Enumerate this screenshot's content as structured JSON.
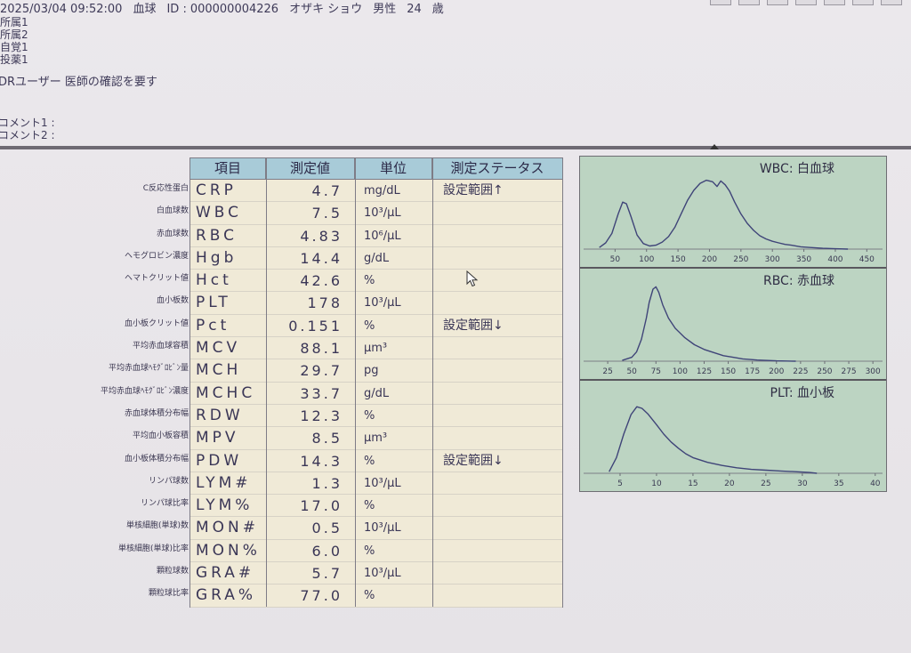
{
  "header": {
    "datetime": "2025/03/04 09:52:00",
    "test": "血球",
    "id_label": "ID :",
    "id": "000000004226",
    "name": "オザキ ショウ",
    "sex": "男性",
    "age": "24",
    "age_unit": "歳",
    "lines": [
      "所属1",
      "所属2",
      "自覚1",
      "投薬1"
    ],
    "dr_note": "DRユーザー 医師の確認を要す",
    "comment1": "コメント1 :",
    "comment2": "コメント2 :"
  },
  "table": {
    "headers": [
      "項目",
      "測定値",
      "単位",
      "測定ステータス"
    ],
    "rows": [
      {
        "label": "C反応性蛋白",
        "item": "CRP",
        "value": "4.7",
        "unit": "mg/dL",
        "status": "設定範囲↑"
      },
      {
        "label": "白血球数",
        "item": "WBC",
        "value": "7.5",
        "unit": "10³/μL",
        "status": ""
      },
      {
        "label": "赤血球数",
        "item": "RBC",
        "value": "4.83",
        "unit": "10⁶/μL",
        "status": ""
      },
      {
        "label": "ヘモグロビン濃度",
        "item": "Hgb",
        "value": "14.4",
        "unit": "g/dL",
        "status": ""
      },
      {
        "label": "ヘマトクリット値",
        "item": "Hct",
        "value": "42.6",
        "unit": "%",
        "status": ""
      },
      {
        "label": "血小板数",
        "item": "PLT",
        "value": "178",
        "unit": "10³/μL",
        "status": ""
      },
      {
        "label": "血小板クリット値",
        "item": "Pct",
        "value": "0.151",
        "unit": "%",
        "status": "設定範囲↓"
      },
      {
        "label": "平均赤血球容積",
        "item": "MCV",
        "value": "88.1",
        "unit": "μm³",
        "status": ""
      },
      {
        "label": "平均赤血球ﾍﾓｸﾞﾛﾋﾞﾝ量",
        "item": "MCH",
        "value": "29.7",
        "unit": "pg",
        "status": ""
      },
      {
        "label": "平均赤血球ﾍﾓｸﾞﾛﾋﾞﾝ濃度",
        "item": "MCHC",
        "value": "33.7",
        "unit": "g/dL",
        "status": ""
      },
      {
        "label": "赤血球体積分布幅",
        "item": "RDW",
        "value": "12.3",
        "unit": "%",
        "status": ""
      },
      {
        "label": "平均血小板容積",
        "item": "MPV",
        "value": "8.5",
        "unit": "μm³",
        "status": ""
      },
      {
        "label": "血小板体積分布幅",
        "item": "PDW",
        "value": "14.3",
        "unit": "%",
        "status": "設定範囲↓"
      },
      {
        "label": "リンパ球数",
        "item": "LYM#",
        "value": "1.3",
        "unit": "10³/μL",
        "status": ""
      },
      {
        "label": "リンパ球比率",
        "item": "LYM%",
        "value": "17.0",
        "unit": "%",
        "status": ""
      },
      {
        "label": "単核細胞(単球)数",
        "item": "MON#",
        "value": "0.5",
        "unit": "10³/μL",
        "status": ""
      },
      {
        "label": "単核細胞(単球)比率",
        "item": "MON%",
        "value": "6.0",
        "unit": "%",
        "status": ""
      },
      {
        "label": "顆粒球数",
        "item": "GRA#",
        "value": "5.7",
        "unit": "10³/μL",
        "status": ""
      },
      {
        "label": "顆粒球比率",
        "item": "GRA%",
        "value": "77.0",
        "unit": "%",
        "status": ""
      }
    ]
  },
  "histograms": [
    {
      "title": "WBC: 白血球",
      "ticks": [
        50,
        100,
        150,
        200,
        250,
        300,
        350,
        400,
        450
      ],
      "xrange": [
        0,
        475
      ],
      "curve_x": [
        25,
        35,
        45,
        55,
        62,
        68,
        75,
        85,
        95,
        105,
        115,
        125,
        135,
        145,
        155,
        165,
        175,
        185,
        195,
        205,
        212,
        218,
        225,
        232,
        240,
        250,
        260,
        270,
        280,
        290,
        300,
        310,
        320,
        330,
        345,
        360,
        380,
        400,
        420
      ],
      "curve_y": [
        0.02,
        0.08,
        0.2,
        0.45,
        0.6,
        0.58,
        0.42,
        0.18,
        0.07,
        0.04,
        0.05,
        0.09,
        0.16,
        0.28,
        0.45,
        0.62,
        0.75,
        0.84,
        0.88,
        0.86,
        0.8,
        0.87,
        0.82,
        0.74,
        0.6,
        0.45,
        0.33,
        0.24,
        0.17,
        0.13,
        0.1,
        0.08,
        0.06,
        0.05,
        0.03,
        0.02,
        0.01,
        0.005,
        0
      ]
    },
    {
      "title": "RBC: 赤血球",
      "ticks": [
        25,
        50,
        75,
        100,
        125,
        150,
        175,
        200,
        225,
        250,
        275,
        300
      ],
      "xrange": [
        0,
        310
      ],
      "curve_x": [
        40,
        50,
        55,
        60,
        65,
        68,
        72,
        75,
        78,
        82,
        88,
        95,
        105,
        115,
        125,
        135,
        145,
        155,
        165,
        180,
        200,
        220
      ],
      "curve_y": [
        0.01,
        0.05,
        0.12,
        0.28,
        0.55,
        0.75,
        0.92,
        0.95,
        0.88,
        0.72,
        0.55,
        0.42,
        0.3,
        0.21,
        0.15,
        0.11,
        0.07,
        0.05,
        0.03,
        0.015,
        0.005,
        0
      ]
    },
    {
      "title": "PLT: 血小板",
      "ticks": [
        5,
        10,
        15,
        20,
        25,
        30,
        35,
        40
      ],
      "xrange": [
        0,
        41
      ],
      "curve_x": [
        3.5,
        4.5,
        5.5,
        6.5,
        7.3,
        8,
        8.8,
        10,
        11,
        12,
        13,
        14,
        15,
        17,
        19,
        21,
        23,
        25,
        27,
        29,
        31,
        32
      ],
      "curve_y": [
        0.02,
        0.2,
        0.5,
        0.75,
        0.85,
        0.83,
        0.76,
        0.62,
        0.5,
        0.4,
        0.32,
        0.25,
        0.2,
        0.14,
        0.1,
        0.07,
        0.05,
        0.04,
        0.03,
        0.02,
        0.01,
        0
      ]
    }
  ]
}
